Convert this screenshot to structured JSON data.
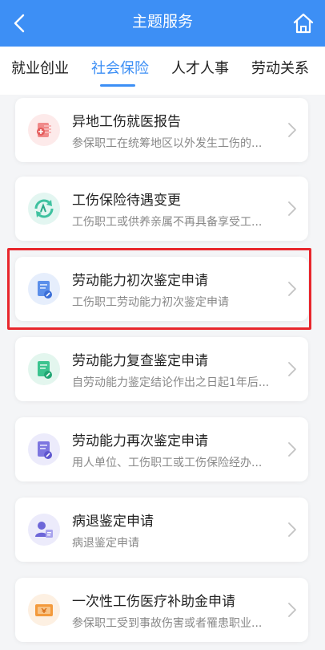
{
  "header": {
    "title": "主题服务"
  },
  "tabs": [
    {
      "label": "就业创业"
    },
    {
      "label": "社会保险"
    },
    {
      "label": "人才人事"
    },
    {
      "label": "劳动关系"
    }
  ],
  "items": [
    {
      "title": "异地工伤就医报告",
      "desc": "参保职工在统筹地区以外发生工伤的...",
      "icon": "medical-report-icon"
    },
    {
      "title": "工伤保险待遇变更",
      "desc": "工伤职工或供养亲属不再具备享受工...",
      "icon": "refresh-change-icon"
    },
    {
      "title": "劳动能力初次鉴定申请",
      "desc": "工伤职工劳动能力初次鉴定申请",
      "icon": "document-edit-icon"
    },
    {
      "title": "劳动能力复查鉴定申请",
      "desc": "自劳动能力鉴定结论作出之日起1年后...",
      "icon": "document-edit-icon"
    },
    {
      "title": "劳动能力再次鉴定申请",
      "desc": "用人单位、工伤职工或工伤保险经办...",
      "icon": "document-edit-icon"
    },
    {
      "title": "病退鉴定申请",
      "desc": "病退鉴定申请",
      "icon": "person-document-icon"
    },
    {
      "title": "一次性工伤医疗补助金申请",
      "desc": "参保职工受到事故伤害或者罹患职业...",
      "icon": "money-payment-icon"
    }
  ],
  "colors": {
    "primary": "#3d8ff5",
    "highlight": "#e8262c"
  }
}
